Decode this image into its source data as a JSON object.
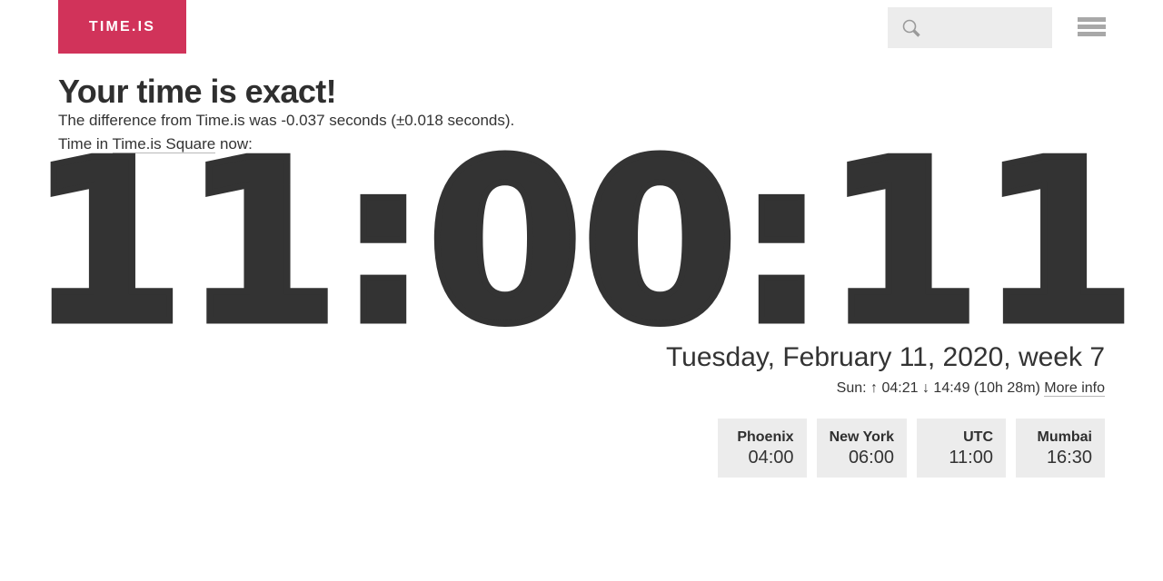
{
  "header": {
    "logo_text": "TIME.IS",
    "logo_color": "#d1335a",
    "search": {
      "icon": "search-icon",
      "value": "",
      "placeholder": ""
    },
    "menu_icon": "hamburger-menu-icon"
  },
  "main": {
    "headline": "Your time is exact!",
    "difference_text": "The difference from Time.is was -0.037 seconds (±0.018 seconds).",
    "location_prefix": "Time in ",
    "location_link": "Time.is Square",
    "location_suffix": " now:",
    "clock": "11:00:11",
    "date": "Tuesday, February 11, 2020, week 7",
    "sun": {
      "label": "Sun:",
      "sunrise_arrow": "↑",
      "sunrise": "04:21",
      "sunset_arrow": "↓",
      "sunset": "14:49",
      "daylength": "(10h 28m)",
      "more_info_link": "More info"
    }
  },
  "cities": [
    {
      "name": "Phoenix",
      "time": "04:00"
    },
    {
      "name": "New York",
      "time": "06:00"
    },
    {
      "name": "UTC",
      "time": "11:00"
    },
    {
      "name": "Mumbai",
      "time": "16:30"
    }
  ]
}
